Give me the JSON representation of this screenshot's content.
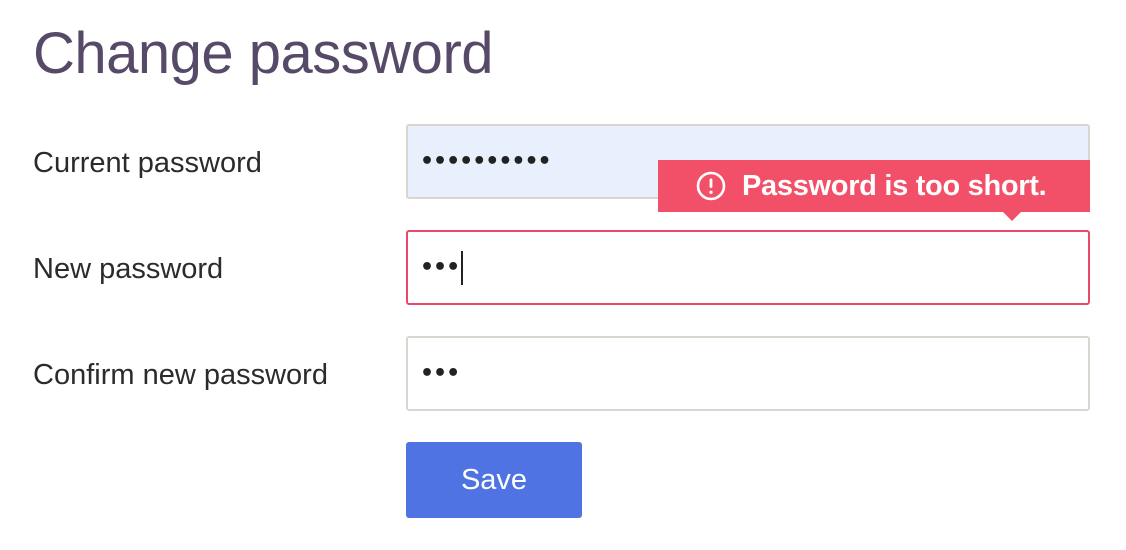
{
  "page": {
    "title": "Change password"
  },
  "form": {
    "current_password": {
      "label": "Current password",
      "masked_value": "••••••••••"
    },
    "new_password": {
      "label": "New password",
      "masked_value": "•••",
      "error": "Password is too short."
    },
    "confirm_password": {
      "label": "Confirm new password",
      "masked_value": "•••"
    },
    "save_label": "Save"
  },
  "icons": {
    "error": "alert-circle-icon"
  },
  "colors": {
    "title": "#574a68",
    "autofill_bg": "#e8f0fe",
    "error": "#f24f68",
    "error_border": "#e94a67",
    "primary_button": "#4f73e3"
  }
}
